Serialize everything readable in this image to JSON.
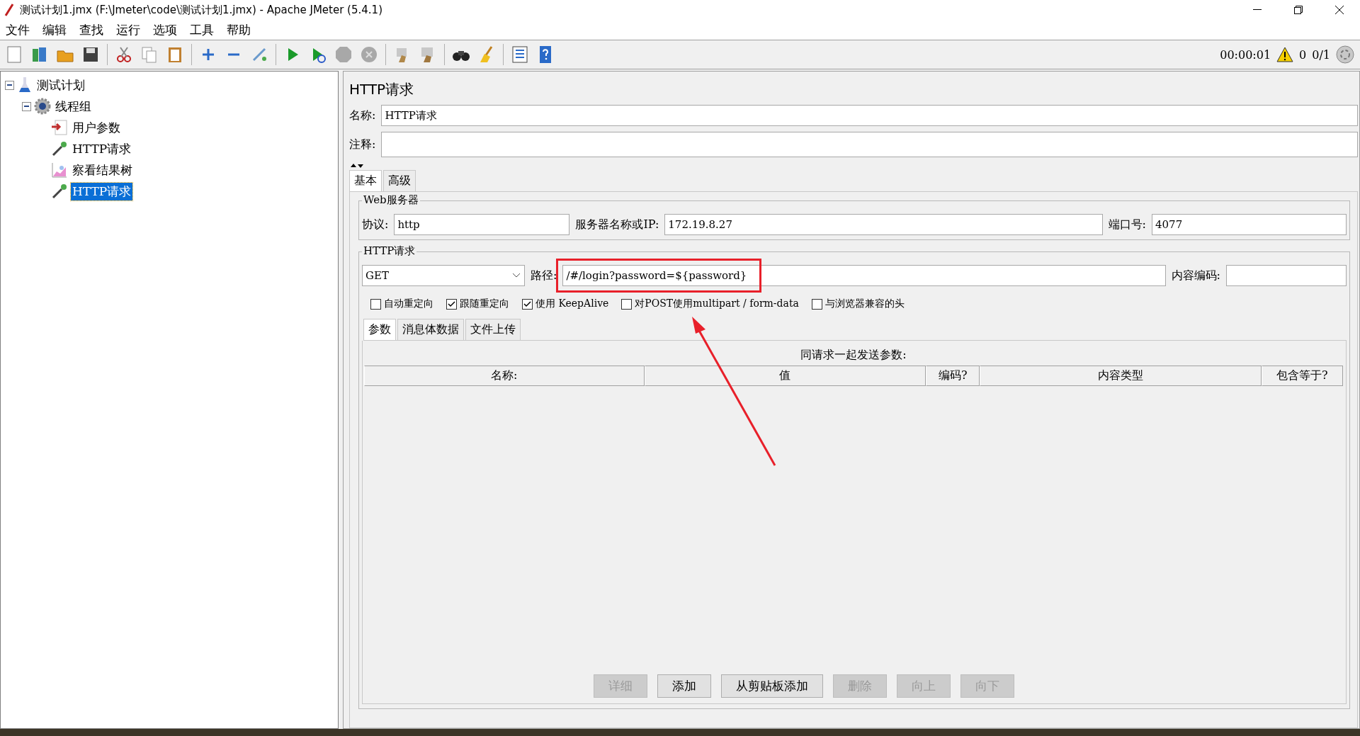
{
  "window": {
    "title": "测试计划1.jmx (F:\\Jmeter\\code\\测试计划1.jmx) - Apache JMeter (5.4.1)"
  },
  "menu": [
    "文件",
    "编辑",
    "查找",
    "运行",
    "选项",
    "工具",
    "帮助"
  ],
  "status": {
    "time": "00:00:01",
    "warnings": "0",
    "threads": "0/1"
  },
  "tree": [
    {
      "label": "测试计划",
      "kind": "plan",
      "selected": false,
      "expanded": true,
      "children": [
        {
          "label": "线程组",
          "kind": "threads",
          "selected": false,
          "expanded": true,
          "children": [
            {
              "label": "用户参数",
              "kind": "params",
              "selected": false
            },
            {
              "label": "HTTP请求",
              "kind": "sampler",
              "selected": false
            },
            {
              "label": "察看结果树",
              "kind": "listener",
              "selected": false
            },
            {
              "label": "HTTP请求",
              "kind": "sampler",
              "selected": true
            }
          ]
        }
      ]
    }
  ],
  "panel": {
    "title": "HTTP请求",
    "name_label": "名称:",
    "name_value": "HTTP请求",
    "comment_label": "注释:"
  },
  "tabs": [
    {
      "label": "基本",
      "selected": true
    },
    {
      "label": "高级",
      "selected": false
    }
  ],
  "web_server": {
    "legend": "Web服务器",
    "protocol_label": "协议:",
    "protocol": "http",
    "server_label": "服务器名称或IP:",
    "server": "172.19.8.27",
    "port_label": "端口号:",
    "port": "4077"
  },
  "http_request": {
    "legend": "HTTP请求",
    "method": "GET",
    "path_label": "路径:",
    "path": "/#/login?password=${password}",
    "encoding_label": "内容编码:"
  },
  "options": [
    {
      "label": "自动重定向",
      "checked": false
    },
    {
      "label": "跟随重定向",
      "checked": true
    },
    {
      "label": "使用 KeepAlive",
      "checked": true
    },
    {
      "label": "对POST使用multipart / form-data",
      "checked": false
    },
    {
      "label": "与浏览器兼容的头",
      "checked": false
    }
  ],
  "sub_tabs": [
    {
      "label": "参数",
      "selected": true
    },
    {
      "label": "消息体数据",
      "selected": false
    },
    {
      "label": "文件上传",
      "selected": false
    }
  ],
  "params": {
    "title": "同请求一起发送参数:",
    "columns": [
      "名称:",
      "值",
      "编码?",
      "内容类型",
      "包含等于?"
    ]
  },
  "buttons": [
    {
      "label": "详细",
      "disabled": true
    },
    {
      "label": "添加",
      "disabled": false
    },
    {
      "label": "从剪贴板添加",
      "disabled": false
    },
    {
      "label": "删除",
      "disabled": true
    },
    {
      "label": "向上",
      "disabled": true
    },
    {
      "label": "向下",
      "disabled": true
    }
  ]
}
